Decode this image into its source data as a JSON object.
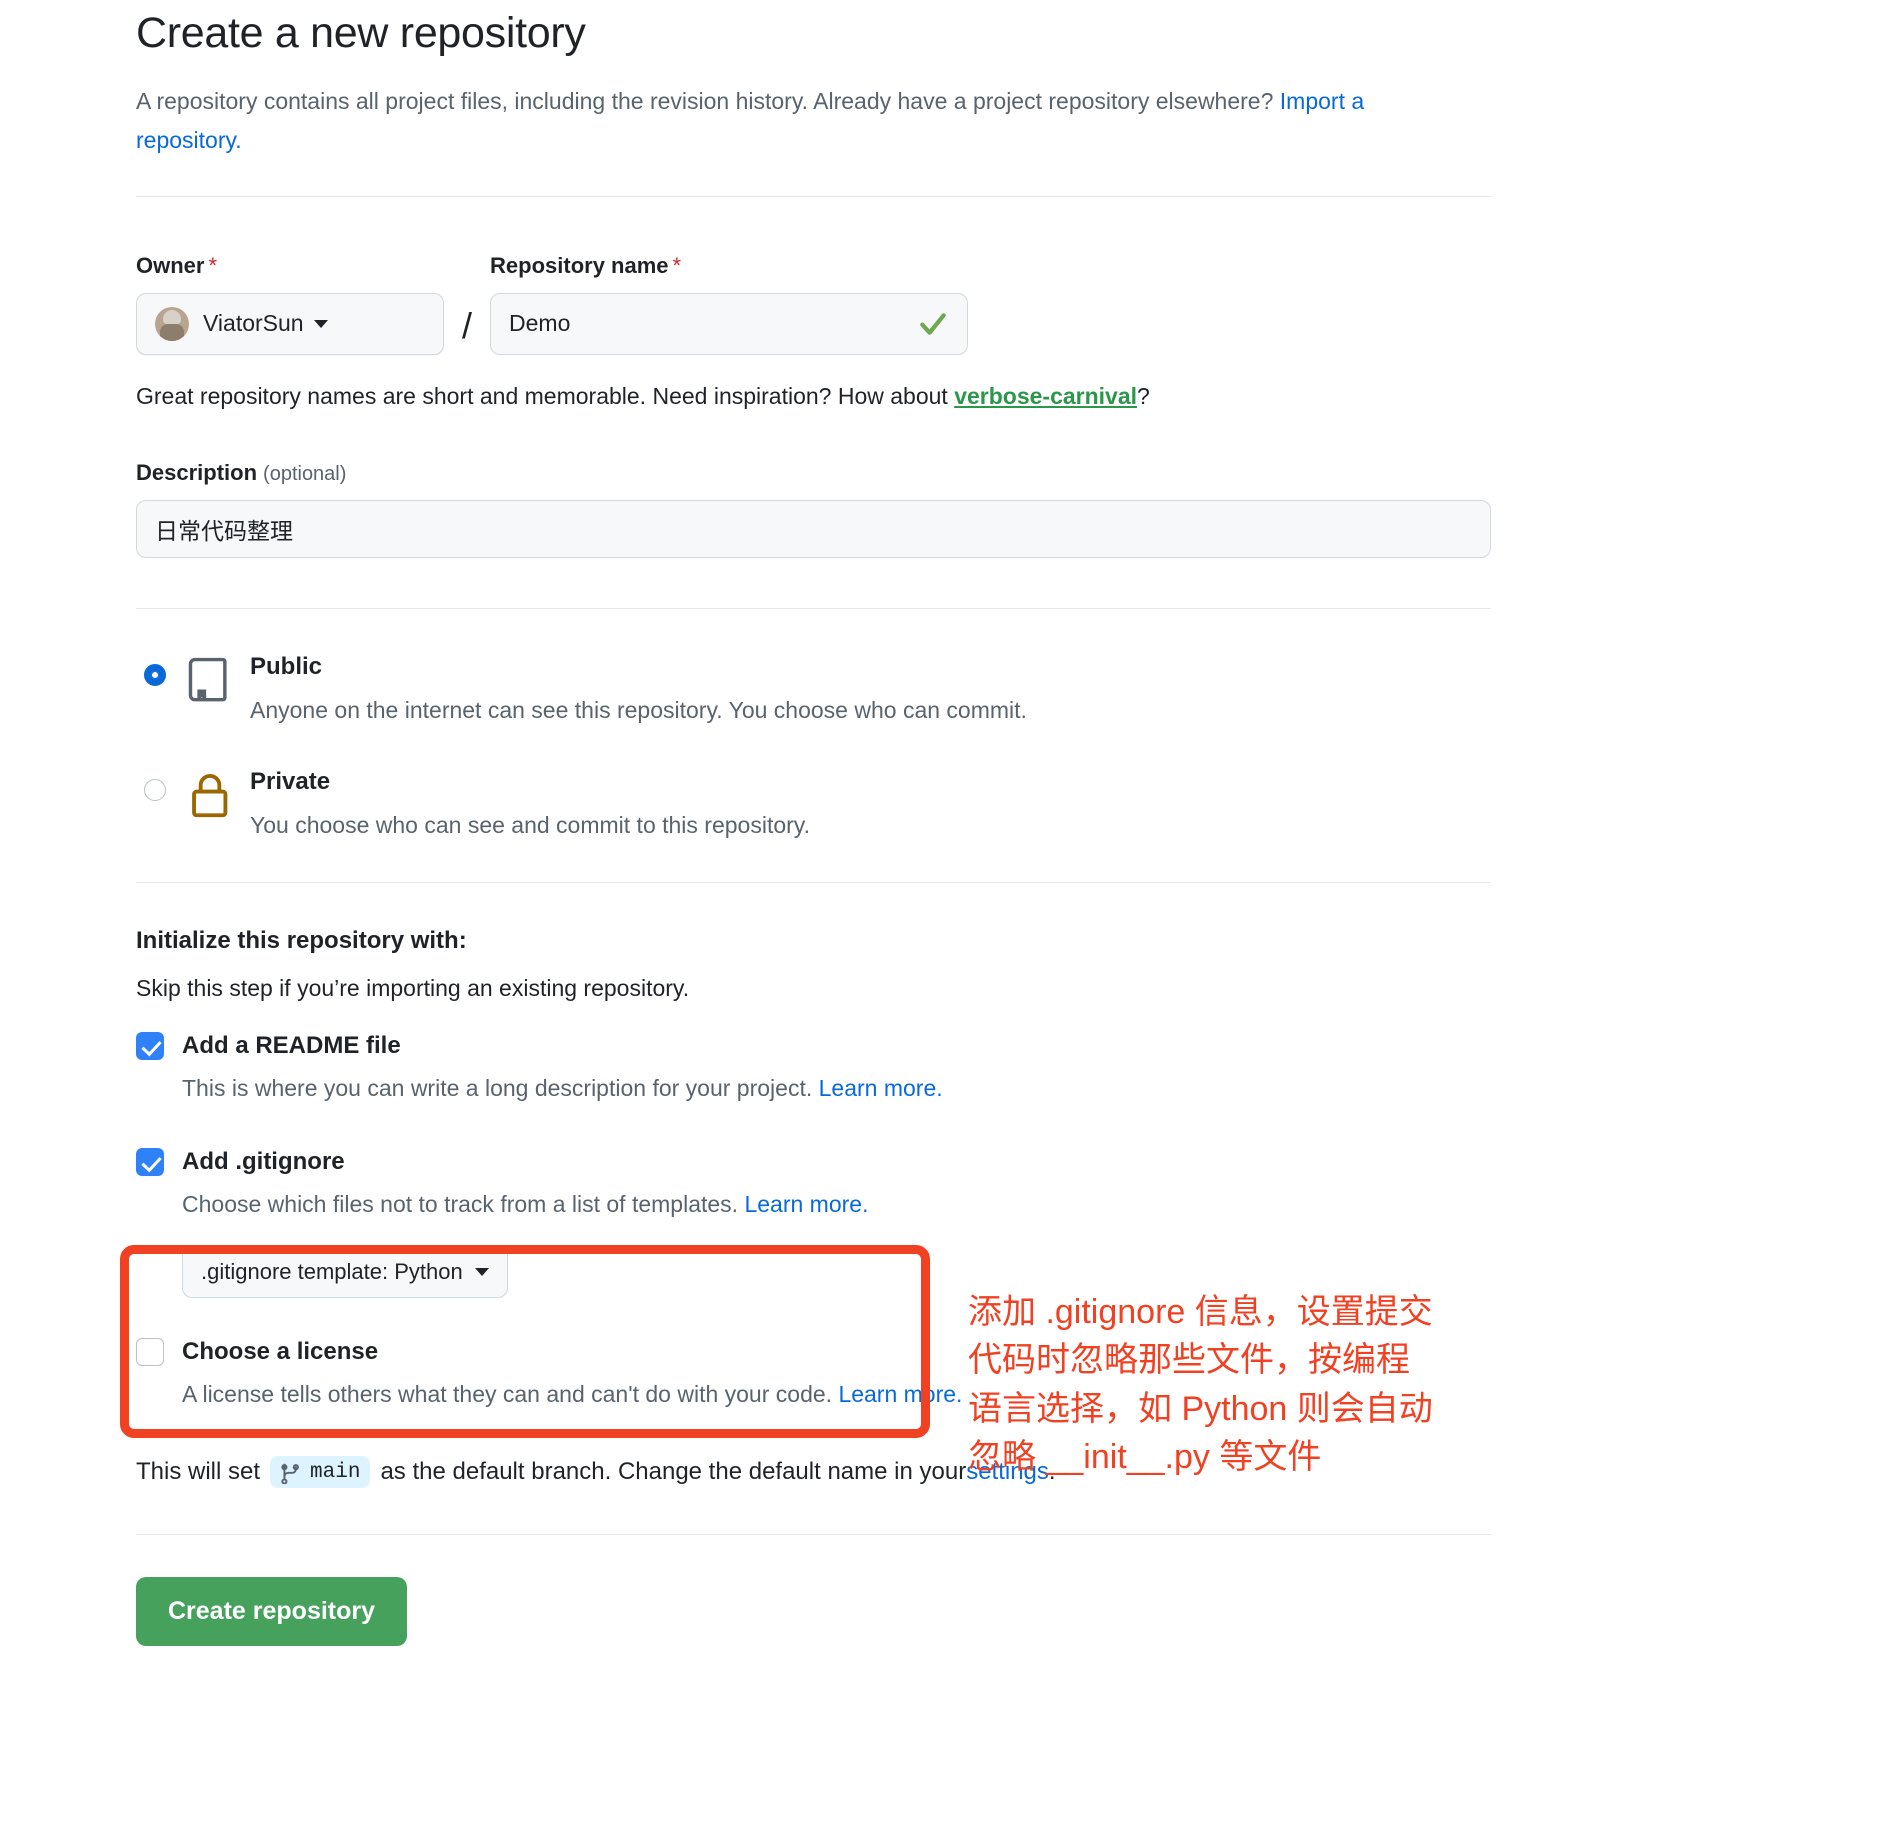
{
  "header": {
    "title": "Create a new repository",
    "description_part1": "A repository contains all project files, including the revision history. Already have a project repository elsewhere? ",
    "import_link": "Import a repository."
  },
  "owner": {
    "label": "Owner",
    "required_mark": "*",
    "name": "ViatorSun",
    "avatar_name": "user-avatar"
  },
  "repo_name": {
    "label": "Repository name",
    "required_mark": "*",
    "value": "Demo",
    "valid": true
  },
  "separator": "/",
  "name_hint": {
    "before": "Great repository names are short and memorable. Need inspiration? How about ",
    "suggestion": "verbose-carnival",
    "after": "?"
  },
  "description": {
    "label": "Description",
    "optional": "(optional)",
    "value": "日常代码整理"
  },
  "visibility": {
    "options": [
      {
        "id": "public",
        "title": "Public",
        "description": "Anyone on the internet can see this repository. You choose who can commit.",
        "selected": true,
        "icon": "repo-book-icon"
      },
      {
        "id": "private",
        "title": "Private",
        "description": "You choose who can see and commit to this repository.",
        "selected": false,
        "icon": "lock-icon"
      }
    ]
  },
  "initialize": {
    "title": "Initialize this repository with:",
    "subtitle": "Skip this step if you’re importing an existing repository.",
    "options": [
      {
        "id": "readme",
        "label": "Add a README file",
        "description": "This is where you can write a long description for your project. ",
        "learn_more": "Learn more.",
        "checked": true
      },
      {
        "id": "gitignore",
        "label": "Add .gitignore",
        "description": "Choose which files not to track from a list of templates. ",
        "learn_more": "Learn more.",
        "checked": true,
        "template_button": ".gitignore template: Python"
      },
      {
        "id": "license",
        "label": "Choose a license",
        "description": "A license tells others what they can and can't do with your code. ",
        "learn_more": "Learn more.",
        "checked": false
      }
    ]
  },
  "branch_note": {
    "before": "This will set",
    "branch": "main",
    "middle": "as the default branch. Change the default name in your ",
    "settings_link": "settings",
    "after": "."
  },
  "submit": {
    "label": "Create repository"
  },
  "annotation": {
    "text": "添加 .gitignore 信息，设置提交\n代码时忽略那些文件，按编程\n语言选择，如 Python 则会自动\n忽略 __init__.py 等文件",
    "color": "#f04123"
  },
  "colors": {
    "link": "#0969da",
    "suggestion_green": "#2c974b",
    "button_green": "#46a15d",
    "annotation_red": "#f04123",
    "lock_gold": "#9a6700",
    "radio_blue": "#0969da",
    "checkbox_blue": "#2f81f7"
  }
}
